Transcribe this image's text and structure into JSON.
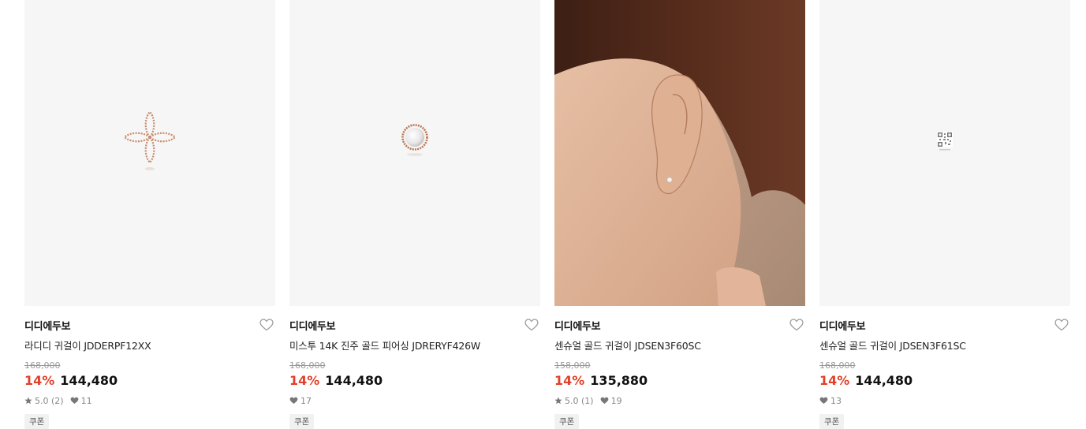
{
  "products": [
    {
      "brand": "디디에두보",
      "name": "라디디 귀걸이 JDDERPF12XX",
      "original_price": "168,000",
      "discount": "14%",
      "price": "144,480",
      "rating": "5.0 (2)",
      "likes": "11",
      "badge": "쿠폰",
      "image": "flower-earring"
    },
    {
      "brand": "디디에두보",
      "name": "미스투 14K 진주 골드 피어싱 JDRERYF426W",
      "original_price": "168,000",
      "discount": "14%",
      "price": "144,480",
      "rating": "",
      "likes": "17",
      "badge": "쿠폰",
      "image": "pearl-earring"
    },
    {
      "brand": "디디에두보",
      "name": "센슈얼 골드 귀걸이 JDSEN3F60SC",
      "original_price": "158,000",
      "discount": "14%",
      "price": "135,880",
      "rating": "5.0 (1)",
      "likes": "19",
      "badge": "쿠폰",
      "image": "model-ear-photo"
    },
    {
      "brand": "디디에두보",
      "name": "센슈얼 골드 귀걸이 JDSEN3F61SC",
      "original_price": "168,000",
      "discount": "14%",
      "price": "144,480",
      "rating": "",
      "likes": "13",
      "badge": "쿠폰",
      "image": "small-qr-thumbnail"
    }
  ],
  "colors": {
    "discount": "#e2412a",
    "thumb_bg": "#f6f6f6",
    "rose_gold": "#c98a6a"
  }
}
